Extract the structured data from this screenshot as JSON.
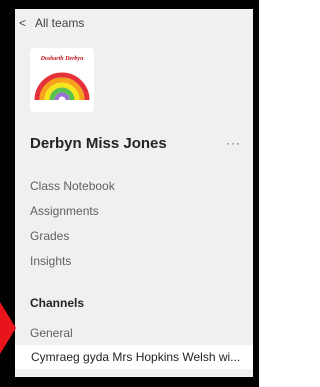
{
  "back": {
    "label": "All teams"
  },
  "team": {
    "logo_text": "Dosbarth Derbyn",
    "name": "Derbyn Miss Jones",
    "more": "···"
  },
  "nav": [
    "Class Notebook",
    "Assignments",
    "Grades",
    "Insights"
  ],
  "channels": {
    "heading": "Channels",
    "items": [
      "General",
      "Cymraeg gyda Mrs Hopkins Welsh wi..."
    ]
  },
  "colors": {
    "frame": "#000000",
    "panel": "#f0f0f0",
    "selected": "#ffffff",
    "arrow": "#e8141b"
  }
}
